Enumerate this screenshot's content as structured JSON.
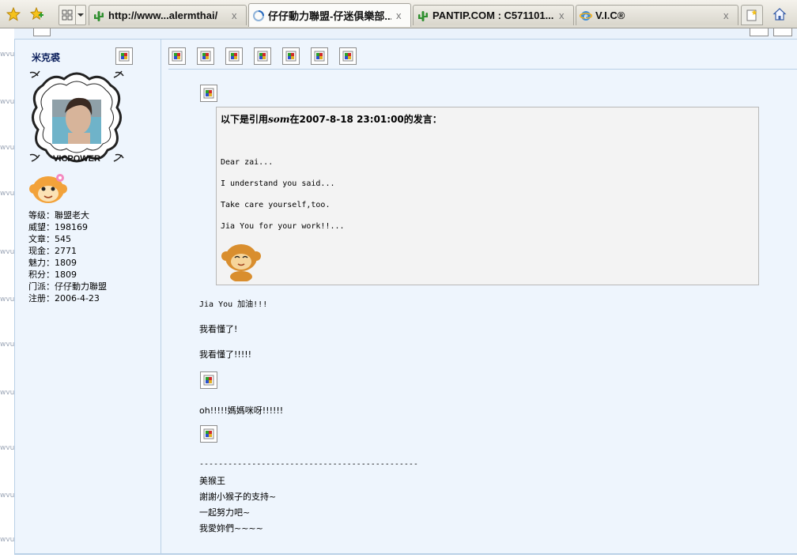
{
  "browser": {
    "tabs": [
      {
        "label": "http://www...alermthai/",
        "active": false,
        "icon": "cactus-icon"
      },
      {
        "label": "仔仔動力聯盟-仔迷俱樂部...",
        "active": true,
        "icon": "loading-ring-icon"
      },
      {
        "label": "PANTIP.COM : C571101...",
        "active": false,
        "icon": "cactus-icon"
      },
      {
        "label": "V.I.C®",
        "active": false,
        "icon": "ie-globe-icon"
      }
    ],
    "close_glyph": "x"
  },
  "gutter_marks": [
    "wvu",
    "wvu",
    "wvu",
    "wvu",
    "wvu",
    "wvu",
    "wvu",
    "wvu",
    "wvu",
    "wvu",
    "wvu",
    "wvu"
  ],
  "user": {
    "name": "米克裘",
    "avatar_caption": "VICPOWER",
    "stats": [
      {
        "label": "等级：",
        "value": "聯盟老大"
      },
      {
        "label": "威望：",
        "value": "198169"
      },
      {
        "label": "文章：",
        "value": "545"
      },
      {
        "label": "现金：",
        "value": "2771"
      },
      {
        "label": "魅力：",
        "value": "1809"
      },
      {
        "label": "积分：",
        "value": "1809"
      },
      {
        "label": "门派：",
        "value": "仔仔動力聯盟"
      },
      {
        "label": "注册：",
        "value": "2006-4-23"
      }
    ]
  },
  "post": {
    "quote": {
      "header_prefix": "以下是引用",
      "author": "som",
      "header_suffix": "在2007-8-18 23:01:00的发言：",
      "lines": [
        "Dear zai...",
        "I understand you said...",
        "Take care yourself,too.",
        "Jia You for your work!!..."
      ]
    },
    "lines": [
      "Jia You 加油!!!",
      "我看懂了!",
      "我看懂了!!!!!",
      "oh!!!!!媽媽咪呀!!!!!!"
    ],
    "signature": {
      "separator": "----------------------------------------------",
      "lines": [
        "美猴王",
        "謝謝小猴子的支持~",
        "一起努力吧~",
        "我愛妳們~~~~"
      ]
    }
  }
}
